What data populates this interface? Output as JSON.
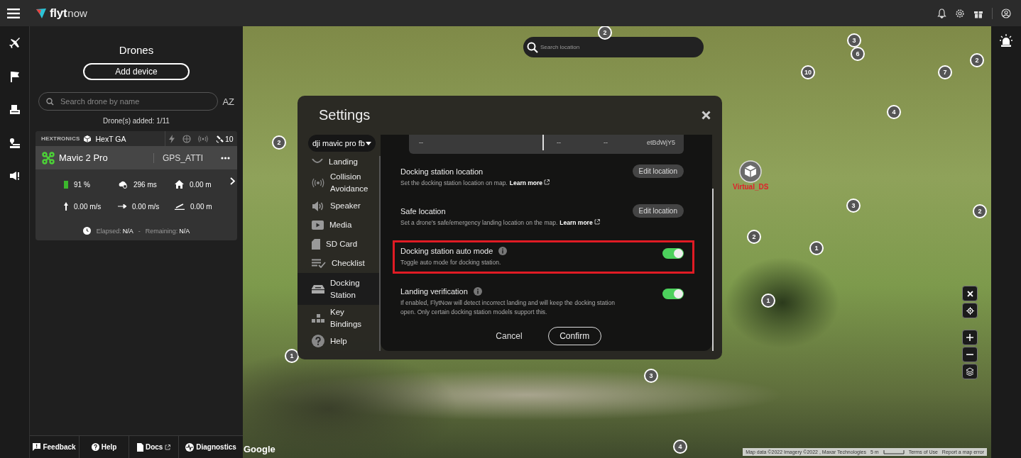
{
  "header": {
    "logo_primary": "flyt",
    "logo_secondary": "now"
  },
  "drones_panel": {
    "title": "Drones",
    "add_button": "Add device",
    "search": {
      "placeholder": "Search drone by name"
    },
    "sort_label": "AZ",
    "count": "Drone(s) added: 1/11"
  },
  "drone_card": {
    "brand": "HEXTRONICS",
    "group": "HexT GA",
    "satellites": "10",
    "name": "Mavic 2 Pro",
    "mode": "GPS_ATTI",
    "stats": [
      {
        "kind": "battery",
        "value": "91 %"
      },
      {
        "kind": "latency",
        "value": "296 ms"
      },
      {
        "kind": "home",
        "value": "0.00 m"
      },
      {
        "kind": "vspeed",
        "value": "0.00 m/s"
      },
      {
        "kind": "hspeed",
        "value": "0.00 m/s"
      },
      {
        "kind": "altitude",
        "value": "0.00 m"
      }
    ],
    "elapsed_label": "Elapsed:",
    "elapsed": "N/A",
    "separator": "-",
    "remaining_label": "Remaining:",
    "remaining": "N/A"
  },
  "footer": [
    {
      "kind": "feedback",
      "label": "Feedback"
    },
    {
      "kind": "help",
      "label": "Help"
    },
    {
      "kind": "docs",
      "label": "Docs"
    },
    {
      "kind": "diagnostics",
      "label": "Diagnostics"
    }
  ],
  "map": {
    "search": {
      "placeholder": "Search location"
    },
    "waypoints": [
      {
        "label": "2"
      },
      {
        "label": "3"
      },
      {
        "label": "6"
      },
      {
        "label": "2"
      },
      {
        "label": "10"
      },
      {
        "label": "7"
      },
      {
        "label": "4"
      },
      {
        "label": "2"
      },
      {
        "label": "3"
      },
      {
        "label": "2"
      },
      {
        "label": "2"
      },
      {
        "label": "1"
      },
      {
        "label": "1"
      },
      {
        "label": "1"
      },
      {
        "label": "3"
      },
      {
        "label": "4"
      }
    ],
    "station_label": "Virtual_DS",
    "google": "Google",
    "attribution": [
      "Map data ©2022 Imagery ©2022 , Maxar Technologies",
      "5 m",
      "Terms of Use",
      "Report a map error"
    ]
  },
  "settings": {
    "title": "Settings",
    "drone_select": "dji mavic pro fb",
    "nav": [
      {
        "kind": "landing",
        "label": "Landing",
        "selected": false
      },
      {
        "kind": "collision",
        "label": "Collision Avoidance",
        "selected": false
      },
      {
        "kind": "speaker",
        "label": "Speaker",
        "selected": false
      },
      {
        "kind": "media",
        "label": "Media",
        "selected": false
      },
      {
        "kind": "sdcard",
        "label": "SD Card",
        "selected": false
      },
      {
        "kind": "checklist",
        "label": "Checklist",
        "selected": false
      },
      {
        "kind": "docking",
        "label": "Docking Station",
        "selected": true
      },
      {
        "kind": "keys",
        "label": "Key Bindings",
        "selected": false
      },
      {
        "kind": "help",
        "label": "Help",
        "selected": false
      }
    ],
    "card_values": [
      "--",
      "--",
      "--",
      "etBdWjY5"
    ],
    "sections": [
      {
        "kind": "action",
        "title": "Docking station location",
        "description": "Set the docking station location on map.",
        "link": "Learn more",
        "button": "Edit location"
      },
      {
        "kind": "action",
        "title": "Safe location",
        "description": "Set a drone's safe/emergency landing location on the map.",
        "link": "Learn more",
        "button": "Edit location"
      },
      {
        "kind": "toggle",
        "title": "Docking station auto mode",
        "description": "Toggle auto mode for docking station.",
        "on": true,
        "highlighted": true
      },
      {
        "kind": "toggle",
        "title": "Landing verification",
        "description": "If enabled, FlytNow will detect incorrect landing and will keep the docking station open. Only certain docking station models support this.",
        "on": true,
        "highlighted": false
      }
    ],
    "cancel": "Cancel",
    "confirm": "Confirm"
  }
}
